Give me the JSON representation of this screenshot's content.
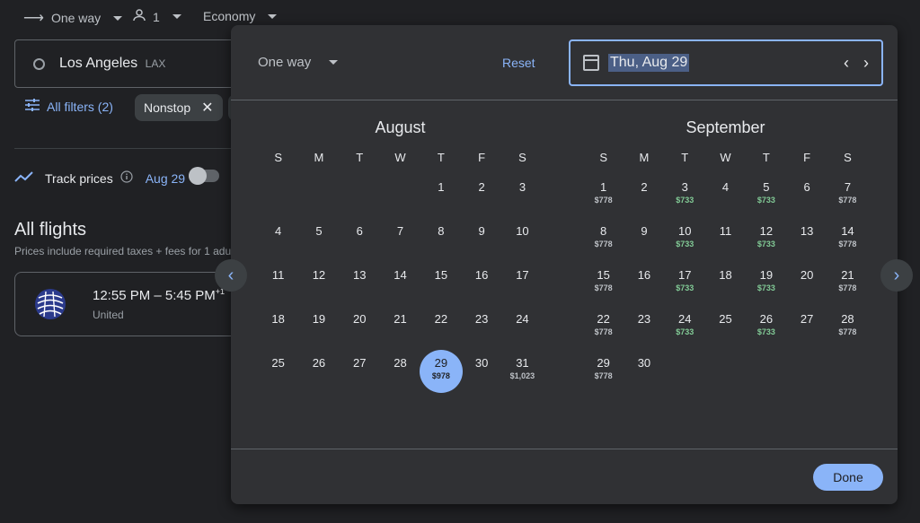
{
  "topbar": {
    "trip_type": "One way",
    "passengers": "1",
    "cabin": "Economy"
  },
  "origin": {
    "city": "Los Angeles",
    "code": "LAX"
  },
  "filters": {
    "all_filters": "All filters (2)",
    "chip_nonstop": "Nonstop"
  },
  "track": {
    "label": "Track prices",
    "date": "Aug 29"
  },
  "results": {
    "heading": "All flights",
    "tax_note": "Prices include required taxes + fees for 1 adul",
    "flight": {
      "times": "12:55 PM – 5:45 PM",
      "plus_day": "+1",
      "airline": "United"
    }
  },
  "dialog": {
    "trip_type": "One way",
    "reset": "Reset",
    "selected_date": "Thu, Aug 29",
    "done": "Done",
    "weekdays": [
      "S",
      "M",
      "T",
      "W",
      "T",
      "F",
      "S"
    ],
    "months": [
      {
        "name": "August",
        "offset": 4,
        "days": [
          {
            "d": "1"
          },
          {
            "d": "2"
          },
          {
            "d": "3"
          },
          {
            "d": "4"
          },
          {
            "d": "5"
          },
          {
            "d": "6"
          },
          {
            "d": "7"
          },
          {
            "d": "8"
          },
          {
            "d": "9"
          },
          {
            "d": "10"
          },
          {
            "d": "11"
          },
          {
            "d": "12"
          },
          {
            "d": "13"
          },
          {
            "d": "14"
          },
          {
            "d": "15"
          },
          {
            "d": "16"
          },
          {
            "d": "17"
          },
          {
            "d": "18"
          },
          {
            "d": "19"
          },
          {
            "d": "20"
          },
          {
            "d": "21"
          },
          {
            "d": "22"
          },
          {
            "d": "23"
          },
          {
            "d": "24"
          },
          {
            "d": "25"
          },
          {
            "d": "26"
          },
          {
            "d": "27"
          },
          {
            "d": "28"
          },
          {
            "d": "29",
            "p": "$978",
            "selected": true
          },
          {
            "d": "30"
          },
          {
            "d": "31",
            "p": "$1,023"
          }
        ]
      },
      {
        "name": "September",
        "offset": 0,
        "days": [
          {
            "d": "1",
            "p": "$778"
          },
          {
            "d": "2"
          },
          {
            "d": "3",
            "p": "$733",
            "low": true
          },
          {
            "d": "4"
          },
          {
            "d": "5",
            "p": "$733",
            "low": true
          },
          {
            "d": "6"
          },
          {
            "d": "7",
            "p": "$778"
          },
          {
            "d": "8",
            "p": "$778"
          },
          {
            "d": "9"
          },
          {
            "d": "10",
            "p": "$733",
            "low": true
          },
          {
            "d": "11"
          },
          {
            "d": "12",
            "p": "$733",
            "low": true
          },
          {
            "d": "13"
          },
          {
            "d": "14",
            "p": "$778"
          },
          {
            "d": "15",
            "p": "$778"
          },
          {
            "d": "16"
          },
          {
            "d": "17",
            "p": "$733",
            "low": true
          },
          {
            "d": "18"
          },
          {
            "d": "19",
            "p": "$733",
            "low": true
          },
          {
            "d": "20"
          },
          {
            "d": "21",
            "p": "$778"
          },
          {
            "d": "22",
            "p": "$778"
          },
          {
            "d": "23"
          },
          {
            "d": "24",
            "p": "$733",
            "low": true
          },
          {
            "d": "25"
          },
          {
            "d": "26",
            "p": "$733",
            "low": true
          },
          {
            "d": "27"
          },
          {
            "d": "28",
            "p": "$778"
          },
          {
            "d": "29",
            "p": "$778"
          },
          {
            "d": "30"
          }
        ]
      }
    ]
  },
  "colors": {
    "accent": "#8ab4f8",
    "low_price": "#81c995",
    "dialog_bg": "#303134",
    "page_bg": "#202124"
  }
}
